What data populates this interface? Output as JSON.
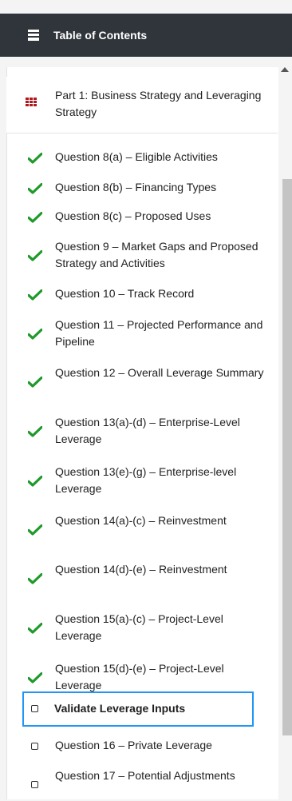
{
  "header": {
    "title": "Table of Contents",
    "icon": "list-icon"
  },
  "part": {
    "label": "Part 1: Business Strategy and Leveraging Strategy",
    "icon": "grid-icon",
    "icon_color": "#b0181f"
  },
  "items": [
    {
      "label": "Question 8(a) – Eligible Activities",
      "status": "complete"
    },
    {
      "label": "Question 8(b) – Financing Types",
      "status": "complete"
    },
    {
      "label": "Question 8(c) – Proposed Uses",
      "status": "complete"
    },
    {
      "label": "Question 9 – Market Gaps and Proposed Strategy and Activities",
      "status": "complete"
    },
    {
      "label": "Question 10 – Track Record",
      "status": "complete"
    },
    {
      "label": "Question 11 – Projected Performance and Pipeline",
      "status": "complete"
    },
    {
      "label": "Question 12 – Overall Leverage Summary",
      "status": "complete"
    },
    {
      "label": "Question 13(a)-(d) – Enterprise-Level Leverage",
      "status": "complete"
    },
    {
      "label": "Question 13(e)-(g) – Enterprise-level Leverage",
      "status": "complete"
    },
    {
      "label": "Question 14(a)-(c) – Reinvestment",
      "status": "complete"
    },
    {
      "label": "Question 14(d)-(e) – Reinvestment",
      "status": "complete"
    },
    {
      "label": "Question 15(a)-(c) – Project-Level Leverage",
      "status": "complete"
    },
    {
      "label": "Question 15(d)-(e) – Project-Level Leverage",
      "status": "complete"
    },
    {
      "label": "Validate Leverage Inputs",
      "status": "incomplete",
      "active": true
    },
    {
      "label": "Question 16 – Private Leverage",
      "status": "incomplete"
    },
    {
      "label": "Question 17 – Potential Adjustments",
      "status": "incomplete"
    }
  ],
  "colors": {
    "header_bg": "#2f353b",
    "check": "#1e9a2a",
    "active_outline": "#2196f3"
  }
}
